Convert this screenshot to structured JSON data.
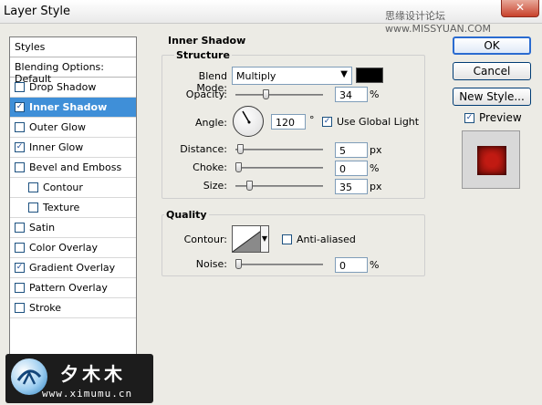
{
  "window": {
    "title": "Layer Style",
    "watermark": "思缘设计论坛  www.MISSYUAN.COM",
    "close_glyph": "✕"
  },
  "styles_panel": {
    "header": "Styles",
    "blending_options": "Blending Options: Default",
    "items": [
      {
        "label": "Drop Shadow",
        "checked": false
      },
      {
        "label": "Inner Shadow",
        "checked": true,
        "selected": true
      },
      {
        "label": "Outer Glow",
        "checked": false
      },
      {
        "label": "Inner Glow",
        "checked": true
      },
      {
        "label": "Bevel and Emboss",
        "checked": false
      },
      {
        "label": "Contour",
        "checked": false,
        "sub": true
      },
      {
        "label": "Texture",
        "checked": false,
        "sub": true
      },
      {
        "label": "Satin",
        "checked": false
      },
      {
        "label": "Color Overlay",
        "checked": false
      },
      {
        "label": "Gradient Overlay",
        "checked": true
      },
      {
        "label": "Pattern Overlay",
        "checked": false
      },
      {
        "label": "Stroke",
        "checked": false
      }
    ]
  },
  "inner_shadow": {
    "section_title": "Inner Shadow",
    "structure": {
      "title": "Structure",
      "blend_mode_label": "Blend Mode:",
      "blend_mode_value": "Multiply",
      "blend_color": "#000000",
      "opacity_label": "Opacity:",
      "opacity_value": "34",
      "opacity_unit": "%",
      "opacity_level": 0.34,
      "angle_label": "Angle:",
      "angle_value": "120",
      "angle_unit": "°",
      "use_global_light_label": "Use Global Light",
      "use_global_light": true,
      "distance_label": "Distance:",
      "distance_value": "5",
      "distance_unit": "px",
      "distance_level": 0.02,
      "choke_label": "Choke:",
      "choke_value": "0",
      "choke_unit": "%",
      "choke_level": 0.0,
      "size_label": "Size:",
      "size_value": "35",
      "size_unit": "px",
      "size_level": 0.14
    },
    "quality": {
      "title": "Quality",
      "contour_label": "Contour:",
      "anti_aliased_label": "Anti-aliased",
      "anti_aliased": false,
      "noise_label": "Noise:",
      "noise_value": "0",
      "noise_unit": "%",
      "noise_level": 0.0
    }
  },
  "buttons": {
    "ok": "OK",
    "cancel": "Cancel",
    "new_style": "New Style...",
    "preview_label": "Preview",
    "preview_checked": true
  },
  "logo": {
    "chinese": "夕木木",
    "url": "www.ximumu.cn"
  },
  "check_glyph": "✓"
}
